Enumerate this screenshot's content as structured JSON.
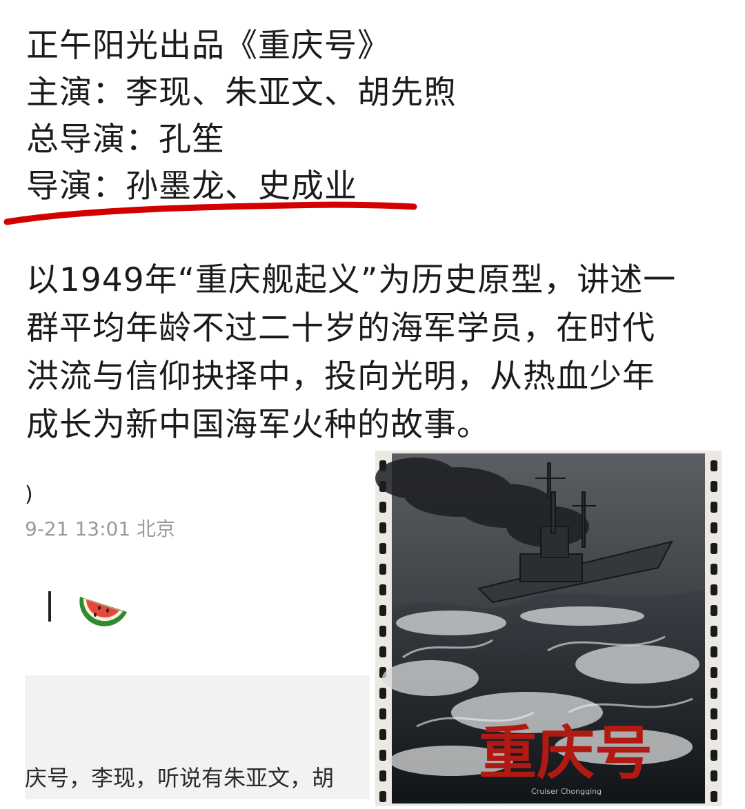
{
  "post": {
    "line1": "正午阳光出品《重庆号》",
    "line2": "主演：李现、朱亚文、胡先煦",
    "line3": "总导演：孔笙",
    "line4": "导演：孙墨龙、史成业",
    "paragraph_lines": [
      "以1949年“重庆舰起义”为历史原型，讲述一",
      "群平均年龄不过二十岁的海军学员，在时代",
      "洪流与信仰抉择中，投向光明，从热血少年",
      "成长为新中国海军火种的故事。"
    ]
  },
  "screenshot": {
    "partial_char": ")",
    "meta": "9-21 13:01 北京",
    "comment": "庆号，李现，听说有朱亚文，胡"
  },
  "poster": {
    "title": "重庆号",
    "subtitle": "Cruiser Chongqing"
  },
  "colors": {
    "underline": "#d40000",
    "poster_title": "#b11a12"
  }
}
